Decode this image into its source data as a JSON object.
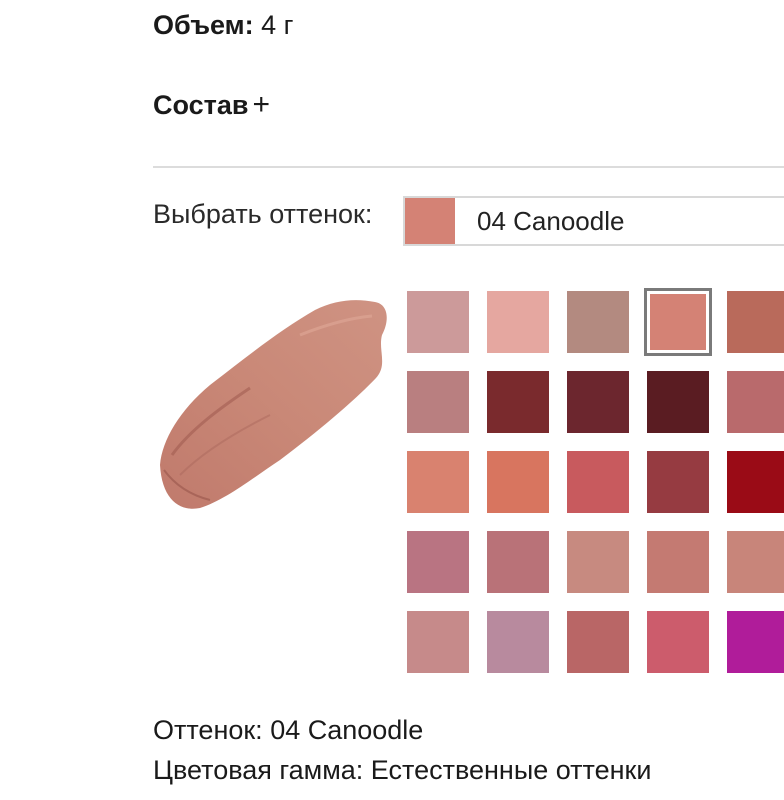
{
  "product": {
    "volume_label": "Объем:",
    "volume_value": "4 г",
    "composition_label": "Состав",
    "composition_toggle": "+"
  },
  "shade_picker": {
    "label": "Выбрать оттенок:",
    "selected_name": "04 Canoodle",
    "selected_color": "#d48275",
    "selected_index": 3,
    "swatches": [
      "#cc9a9a",
      "#e5a7a0",
      "#b38a80",
      "#d48275",
      "#b96a5b",
      "#b97f80",
      "#7a2a2d",
      "#6c262e",
      "#5a1c22",
      "#b96a6c",
      "#d9826f",
      "#d8755f",
      "#c85a5e",
      "#963b41",
      "#9a0b16",
      "#b97482",
      "#b97278",
      "#c78a80",
      "#c47a72",
      "#c8857a",
      "#c68a8a",
      "#b88a9e",
      "#b96666",
      "#cc5c6c",
      "#b01c9a"
    ]
  },
  "info": {
    "shade_line": "Оттенок: 04 Canoodle",
    "palette_line": "Цветовая гамма: Естественные оттенки"
  }
}
